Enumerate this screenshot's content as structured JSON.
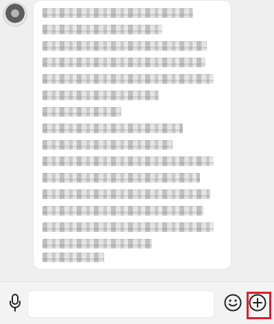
{
  "chat": {
    "message_bubble": {
      "content": "",
      "redacted": true
    }
  },
  "input_bar": {
    "placeholder": "",
    "value": ""
  },
  "icons": {
    "voice": "microphone-icon",
    "emoji": "smiley-icon",
    "more": "plus-circle-icon"
  },
  "highlight": {
    "color": "#e01b2d",
    "target": "more-actions-button"
  }
}
